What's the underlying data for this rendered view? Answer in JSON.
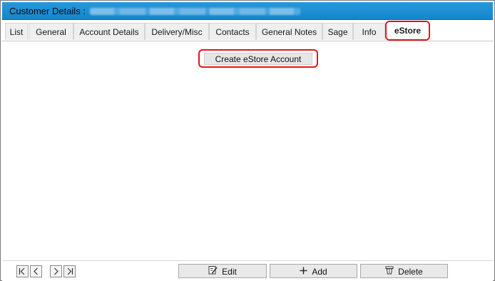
{
  "window": {
    "title": "Customer Details :"
  },
  "tabs": [
    {
      "label": "List"
    },
    {
      "label": "General"
    },
    {
      "label": "Account Details"
    },
    {
      "label": "Delivery/Misc"
    },
    {
      "label": "Contacts"
    },
    {
      "label": "General Notes"
    },
    {
      "label": "Sage"
    },
    {
      "label": "Info"
    },
    {
      "label": "eStore",
      "active": true
    }
  ],
  "estore": {
    "create_label": "Create eStore Account"
  },
  "nav": {
    "first_icon": "first-record-icon",
    "prev_icon": "previous-record-icon",
    "next_icon": "next-record-icon",
    "last_icon": "last-record-icon"
  },
  "actions": {
    "edit_label": "Edit",
    "add_label": "Add",
    "delete_label": "Delete"
  },
  "colors": {
    "titlebar": "#1a8ed2",
    "highlight": "#e01818"
  }
}
